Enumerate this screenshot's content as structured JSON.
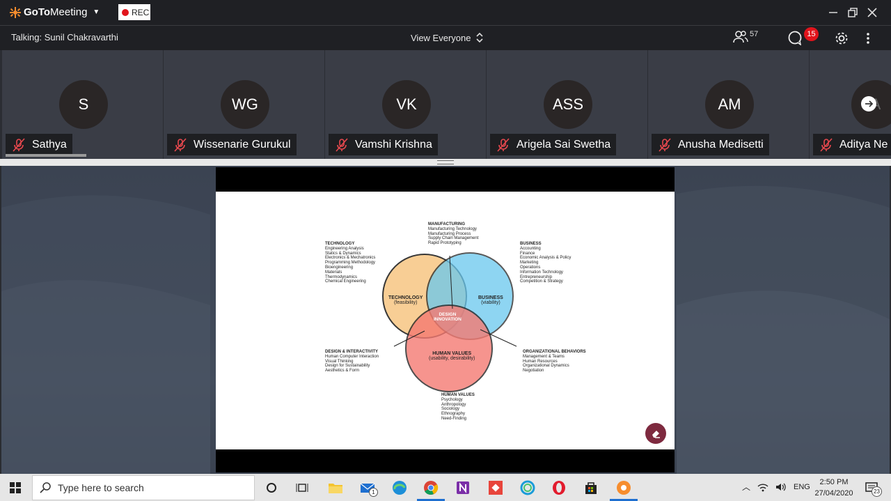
{
  "app": {
    "name_1": "GoTo",
    "name_2": "Meeting",
    "rec_label": "REC"
  },
  "meeting": {
    "talking": "Talking: Sunil Chakravarthi",
    "view_label": "View Everyone",
    "participants_count": "57",
    "chat_badge": "15"
  },
  "participants": [
    {
      "initials": "S",
      "name": "Sathya"
    },
    {
      "initials": "WG",
      "name": "Wissenarie Gurukul"
    },
    {
      "initials": "VK",
      "name": "Vamshi Krishna"
    },
    {
      "initials": "ASS",
      "name": "Arigela Sai Swetha"
    },
    {
      "initials": "AM",
      "name": "Anusha Medisetti"
    },
    {
      "initials": "A",
      "name": "Aditya Ne"
    }
  ],
  "slide": {
    "circles": {
      "technology": {
        "title": "TECHNOLOGY",
        "sub": "(feasibility)"
      },
      "business": {
        "title": "BUSINESS",
        "sub": "(viability)"
      },
      "human": {
        "title": "HUMAN VALUES",
        "sub": "(usability, desirability)"
      },
      "center_1": "DESIGN",
      "center_2": "INNOVATION"
    },
    "manufacturing": {
      "title": "MANUFACTURING",
      "items": "Manufacturing Technology\nManufacturing Process\nSupply Chain Management\nRapid Prototyping"
    },
    "technology": {
      "title": "TECHNOLOGY",
      "items": "Engineering Analysis\nStatics & Dynamics\nElectronics & Mechatronics\nProgramming Methodology\nBioengineering\nMaterials\nThermodynamics\nChemical Engineering"
    },
    "business": {
      "title": "BUSINESS",
      "items": "Accounting\nFinance\nEconomic Analysis & Policy\nMarketing\nOperations\nInformation Technology\nEntrepreneurship\nCompetition & Strategy"
    },
    "design": {
      "title": "DESIGN & INTERACTIVITY",
      "items": "Human Computer Interaction\nVisual Thinking\nDesign for Sustainability\nAesthetics & Form"
    },
    "org": {
      "title": "ORGANIZATIONAL BEHAVIORS",
      "items": "Management & Teams\nHuman Resources\nOrganizational Dynamics\nNegotiation"
    },
    "human_values": {
      "title": "HUMAN VALUES",
      "items": "Psychology\nAnthropology\nSociology\nEthnography\nNeed-Finding"
    }
  },
  "taskbar": {
    "search_placeholder": "Type here to search",
    "mail_badge": "1",
    "lang": "ENG",
    "time": "2:50 PM",
    "date": "27/04/2020",
    "notif": "23"
  },
  "colors": {
    "rec": "#e1141c",
    "tech": "#f8c98a",
    "business": "#69c8ee",
    "human": "#f57a72",
    "slide_button": "#7e2a3f"
  }
}
